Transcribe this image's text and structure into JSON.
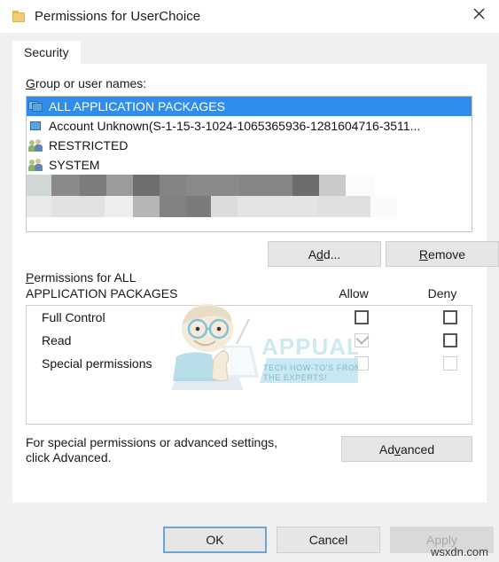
{
  "window": {
    "title": "Permissions for UserChoice",
    "folder_icon": "folder-icon",
    "close_icon": "close-icon"
  },
  "tabs": [
    {
      "label": "Security",
      "active": true
    }
  ],
  "groups_section": {
    "label": "Group or user names:",
    "label_accel": "G",
    "items": [
      {
        "name": "ALL APPLICATION PACKAGES",
        "icon": "app-package-icon",
        "selected": true,
        "censored": false
      },
      {
        "name": "Account Unknown(S-1-15-3-1024-1065365936-1281604716-3511...",
        "icon": "app-package-icon",
        "selected": false,
        "censored": false
      },
      {
        "name": "RESTRICTED",
        "icon": "user-group-icon",
        "selected": false,
        "censored": false
      },
      {
        "name": "SYSTEM",
        "icon": "user-group-icon",
        "selected": false,
        "censored": false
      },
      {
        "name": "",
        "icon": "user-group-icon",
        "selected": false,
        "censored": true
      },
      {
        "name": "",
        "icon": "user-group-icon",
        "selected": false,
        "censored": true
      }
    ]
  },
  "buttons": {
    "add": "Add...",
    "add_accel": "d",
    "remove": "Remove",
    "remove_accel": "R",
    "advanced": "Advanced",
    "advanced_accel": "v",
    "ok": "OK",
    "cancel": "Cancel",
    "apply": "Apply",
    "apply_enabled": false,
    "ok_is_default": true
  },
  "permissions_section": {
    "label_line1": "Permissions for ALL",
    "label_line2": "APPLICATION PACKAGES",
    "label_accel": "P",
    "column_allow": "Allow",
    "column_deny": "Deny",
    "rows": [
      {
        "name": "Full Control",
        "allow_checked": false,
        "allow_enabled": true,
        "deny_checked": false,
        "deny_enabled": true
      },
      {
        "name": "Read",
        "allow_checked": true,
        "allow_enabled": false,
        "deny_checked": false,
        "deny_enabled": true
      },
      {
        "name": "Special permissions",
        "allow_checked": false,
        "allow_enabled": false,
        "deny_checked": false,
        "deny_enabled": false
      }
    ]
  },
  "advanced_note": {
    "line1": "For special permissions or advanced settings,",
    "line2": "click Advanced."
  },
  "watermarks": {
    "brand": "APPUALS",
    "tagline_line1": "TECH HOW-TO'S FROM",
    "tagline_line2": "THE EXPERTS!",
    "source": "wsxdn.com"
  },
  "colors": {
    "selection_blue": "#2f8ded",
    "dialog_bg": "#f0f0f0",
    "panel_bg": "#ffffff",
    "button_bg": "#e6e6e6",
    "default_button_border": "#6aa5d6",
    "disabled_text": "#a8a8a8",
    "watermark_cyan": "#bfe4ef"
  }
}
